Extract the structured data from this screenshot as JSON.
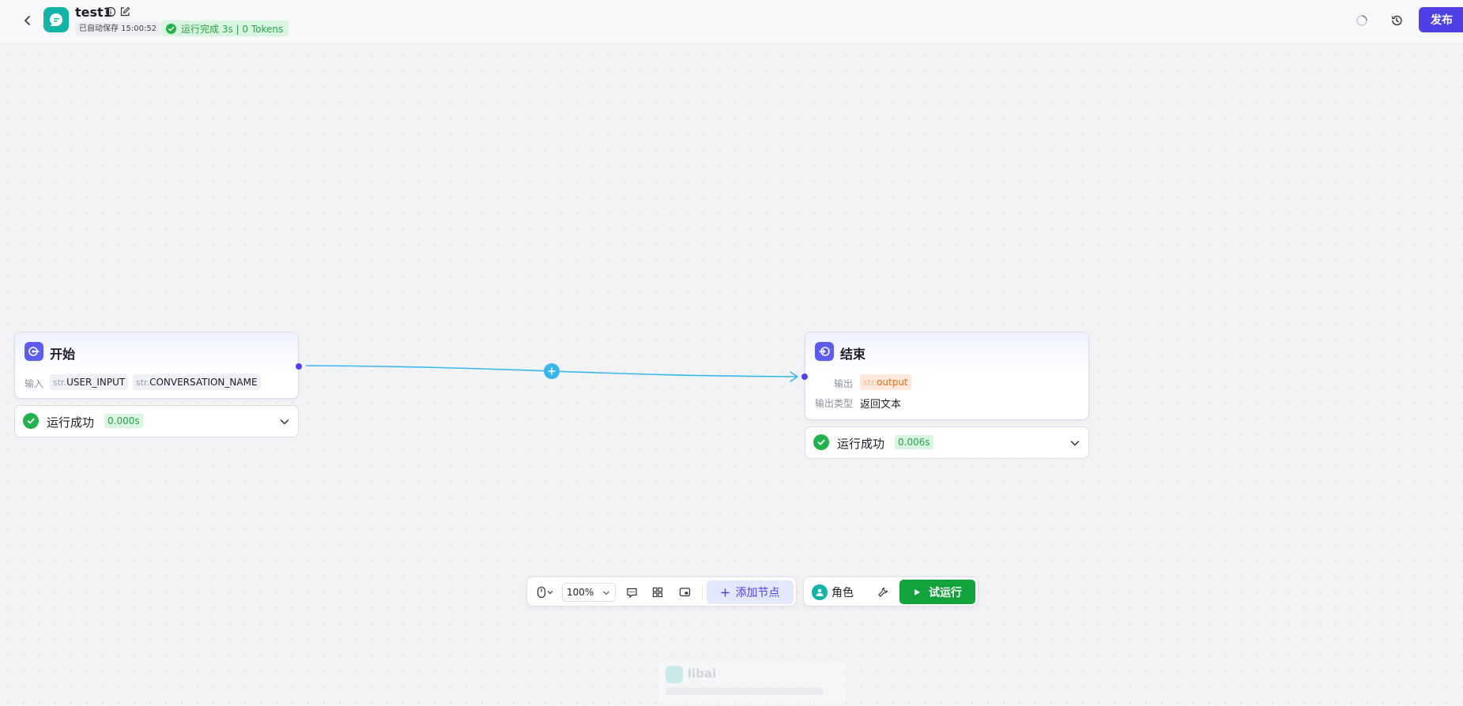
{
  "header": {
    "title": "test1",
    "autosave": "已自动保存 15:00:52",
    "run_status": "运行完成 3s | 0 Tokens",
    "publish_label": "发布"
  },
  "colors": {
    "accent": "#4e40e5",
    "success": "#22b14c",
    "edge": "#3ab6ee",
    "app_logo": "#12b3a8"
  },
  "nodes": {
    "start": {
      "title": "开始",
      "input_label": "输入",
      "inputs": [
        {
          "type": "str.",
          "name": "USER_INPUT"
        },
        {
          "type": "str.",
          "name": "CONVERSATION_NAME"
        }
      ],
      "result": {
        "label": "运行成功",
        "time": "0.000s"
      }
    },
    "end": {
      "title": "结束",
      "output_label": "输出",
      "output": {
        "type": "str.",
        "name": "output"
      },
      "output_type_label": "输出类型",
      "output_type_value": "返回文本",
      "result": {
        "label": "运行成功",
        "time": "0.006s"
      }
    }
  },
  "toolbar": {
    "zoom": "100%",
    "add_node_label": "添加节点",
    "role_label": "角色",
    "try_run_label": "试运行"
  },
  "ghost_card": {
    "name": "libai"
  },
  "icons": [
    "back-arrow-icon",
    "app-chat-icon",
    "info-icon",
    "edit-icon",
    "check-circle-icon",
    "loading-icon",
    "history-icon",
    "start-node-icon",
    "end-node-icon",
    "plus-icon",
    "chevron-down-icon",
    "mouse-icon",
    "comment-icon",
    "grid-icon",
    "minimap-icon",
    "user-icon",
    "wrench-icon",
    "play-icon"
  ]
}
